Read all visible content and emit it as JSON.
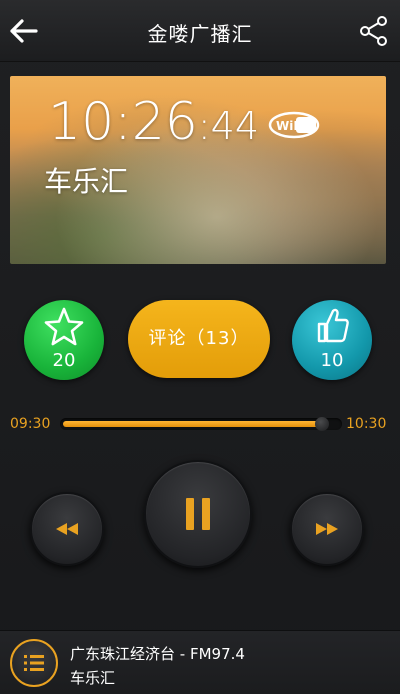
{
  "header": {
    "title": "金喽广播汇",
    "back_icon": "arrow-left-icon",
    "share_icon": "share-icon"
  },
  "cover": {
    "clock_hm": "10:26",
    "clock_sec": ":44",
    "wifi_badge": "WiFi",
    "label": "车乐汇"
  },
  "actions": {
    "favorite_icon": "star-icon",
    "favorite_count": "20",
    "comment_label": "评论（13）",
    "like_icon": "thumbs-up-icon",
    "like_count": "10"
  },
  "player": {
    "start_time": "09:30",
    "end_time": "10:30",
    "progress": 0.94,
    "rewind_icon": "rewind-icon",
    "pause_icon": "pause-icon",
    "forward_icon": "fast-forward-icon"
  },
  "now_playing": {
    "playlist_icon": "playlist-icon",
    "station": "广东珠江经济台 - FM97.4",
    "program": "车乐汇"
  },
  "colors": {
    "accent": "#e9a221",
    "favorite": "#19b43a",
    "comment": "#f1ad15",
    "like": "#1398ab",
    "background": "#1c1d1f"
  }
}
